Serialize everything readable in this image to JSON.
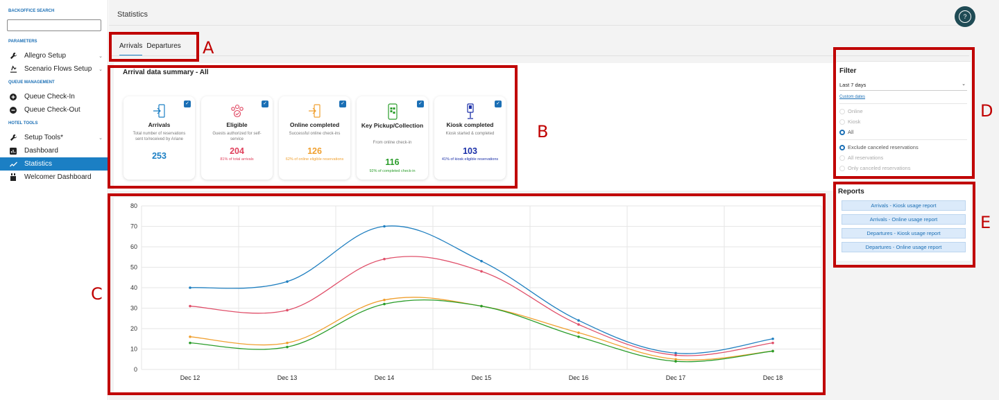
{
  "sidebar": {
    "backoffice_search": "BACKOFFICE SEARCH",
    "sections": {
      "parameters": "PARAMETERS",
      "queue_management": "QUEUE MANAGEMENT",
      "hotel_tools": "HOTEL TOOLS"
    },
    "items": [
      {
        "label": "Allegro Setup",
        "icon": "wrench-icon"
      },
      {
        "label": "Scenario Flows Setup",
        "icon": "flows-icon"
      },
      {
        "label": "Queue Check-In",
        "icon": "plus-circle-icon"
      },
      {
        "label": "Queue Check-Out",
        "icon": "minus-circle-icon"
      },
      {
        "label": "Setup Tools*",
        "icon": "wrench-icon"
      },
      {
        "label": "Dashboard",
        "icon": "dashboard-icon"
      },
      {
        "label": "Statistics",
        "icon": "trend-icon"
      },
      {
        "label": "Welcomer Dashboard",
        "icon": "welcomer-icon"
      }
    ]
  },
  "header": {
    "title": "Statistics",
    "help": "?"
  },
  "tabs": [
    {
      "label": "Arrivals"
    },
    {
      "label": "Departures"
    }
  ],
  "summary": {
    "title": "Arrival data summary - All",
    "cards": [
      {
        "title": "Arrivals",
        "desc": "Total number of reservations sent to/received by Ariane",
        "value": "253",
        "sub": "",
        "color": "#1b7fc4",
        "icon": "door-arrow-icon"
      },
      {
        "title": "Eligible",
        "desc": "Guests authorized for self-service",
        "value": "204",
        "sub": "81% of total arrivals",
        "color": "#e0405c",
        "icon": "people-check-icon"
      },
      {
        "title": "Online completed",
        "desc": "Successful online check-ins",
        "value": "126",
        "sub": "62% of online eligible reservations",
        "color": "#f0a030",
        "icon": "door-arrow-icon"
      },
      {
        "title": "Key Pickup/Collection",
        "desc": "From online check-in",
        "value": "116",
        "sub": "92% of completed check-in",
        "color": "#2a9d2a",
        "icon": "phone-qr-icon"
      },
      {
        "title": "Kiosk completed",
        "desc": "Kiosk started & completed",
        "value": "103",
        "sub": "41% of kiosk eligible reservations",
        "color": "#1a2fa8",
        "icon": "kiosk-icon"
      }
    ]
  },
  "filter": {
    "title": "Filter",
    "select_value": "Last 7 days",
    "custom_dates": "Custom dates",
    "channel_options": [
      "Online",
      "Kiosk",
      "All"
    ],
    "channel_selected": "All",
    "reservation_options": [
      "Exclude canceled reservations",
      "All reservations",
      "Only canceled reservations"
    ],
    "reservation_selected": "Exclude canceled reservations"
  },
  "reports": {
    "title": "Reports",
    "buttons": [
      "Arrivals - Kiosk usage report",
      "Arrivals - Online usage report",
      "Departures - Kiosk usage report",
      "Departures - Online usage report"
    ]
  },
  "callouts": [
    "A",
    "B",
    "C",
    "D",
    "E"
  ],
  "chart_data": {
    "type": "line",
    "categories": [
      "Dec 12",
      "Dec 13",
      "Dec 14",
      "Dec 15",
      "Dec 16",
      "Dec 17",
      "Dec 18"
    ],
    "ylim": [
      0,
      80
    ],
    "yticks": [
      0,
      10,
      20,
      30,
      40,
      50,
      60,
      70,
      80
    ],
    "grid": true,
    "series": [
      {
        "values": [
          40,
          43,
          70,
          53,
          24,
          8,
          15
        ],
        "color": "#1f7fc0"
      },
      {
        "values": [
          31,
          29,
          54,
          48,
          22,
          7,
          13
        ],
        "color": "#e0506a"
      },
      {
        "values": [
          16,
          13,
          34,
          31,
          18,
          5,
          9
        ],
        "color": "#f0a030"
      },
      {
        "values": [
          13,
          11,
          32,
          31,
          16,
          4,
          9
        ],
        "color": "#2a9d2a"
      }
    ]
  }
}
